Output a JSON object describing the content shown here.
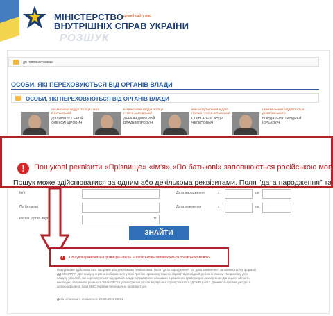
{
  "header": {
    "ministry_line1": "МІНІСТЕРСТВО",
    "ministry_line2": "ВНУТРІШНІХ СПРАВ УКРАЇНИ",
    "rozshuk": "РОЗШУК",
    "top_link": "до веб-сайту мвс"
  },
  "topbar": {
    "text": "до головного меню"
  },
  "section": {
    "title": "ОСОБИ, ЯКІ ПЕРЕХОВУЮТЬСЯ ВІД ОРГАНІВ ВЛАДИ",
    "subtitle": "ОСОБИ, ЯКІ ПЕРЕХОВУЮТЬСЯ ВІД ОРГАНІВ ВЛАДИ"
  },
  "cards": [
    {
      "dept": "ЛУГАНСЬКИЙ ВІДДІЛ ПОЛІЦІЇ ГУНП В ЛУГАНСЬКІЙ",
      "name": "ДОЛИНЧУК СЕРГІЙ ОЛЕКСАНДРОВИЧ"
    },
    {
      "dept": "КУПЯНСЬКИЙ ВІДДІЛ ПОЛІЦІЇ ГУНП В ХАРКІВСЬКІЙ",
      "name": "ДЕРКАЧ ДМИТРИЙ ВЛАДИМИРОВИЧ"
    },
    {
      "dept": "КРАСНОДОНСЬКИЙ ВІДДІЛ ПОЛІЦІЇ ГУНП В ЛУГАНСЬКІЙ",
      "name": "ОГЛЫ АЛЕКСАНДР ЧЕЛЕПОВИЧ"
    },
    {
      "dept": "ЦЕНТРАЛЬНИЙ ВІДДІЛ ПОЛІЦІЇ ДНІПРОВСЬКОГО",
      "name": "БОНДАРЕНКО АНДРЕЙ ЮРЬЕВИЧ"
    }
  ],
  "callout": {
    "icon": "!",
    "error": "Пошукові реквізити «Прізвище» «Ім'я» «По батькові» заповнюються російською мовою.",
    "note": "Пошук може здійснюватися за одним або декількома реквізитами. Поля \"дата народження\" та \"дата зниклення\""
  },
  "form": {
    "labels": {
      "first_name": "Ім'я",
      "patronymic": "По батькові",
      "region": "Регіон (орган внутр.)",
      "birth": "Дата народження",
      "missing": "Дата зникнення",
      "from": "з",
      "to": "по"
    },
    "submit": "ЗНАЙТИ"
  },
  "small_callout": {
    "icon": "!",
    "text": "Пошукові реквізити «Прізвище» «Ім'я» «По батькові» заповнюються російською мовою."
  },
  "bottom": {
    "text": "Пошук може здійснюватися за одним або декількома реквізитами. Поля \"дата народження\" та \"дата зникнення\" заповнюються у форматі ДД.ММ.РРРР. Для пошуку в регіоні обирається у полі \"регіон (орган внутрішніх справ)\" відповідний регіон зі списку. Наприклад, для пошуку усіх осіб, які переховуються від органів влади з правовими ознаками в районних правоохоронних органах Донецької області, необхідно заповнити реквізити \"ІВАНОВ\" та у полі \"регіон (орган внутрішніх справ)\" вказати \"ДОНЕЦЬКА\". Даний пошуковий ресурс є копією офіційної бази МВС України і періодично оновлюється.",
    "date": "Дата останнього оновлення: 20.03.2016 05:51"
  },
  "colors": {
    "callout_border": "#b3232b",
    "accent_blue": "#2a5fa8",
    "error_red": "#c2181f"
  }
}
